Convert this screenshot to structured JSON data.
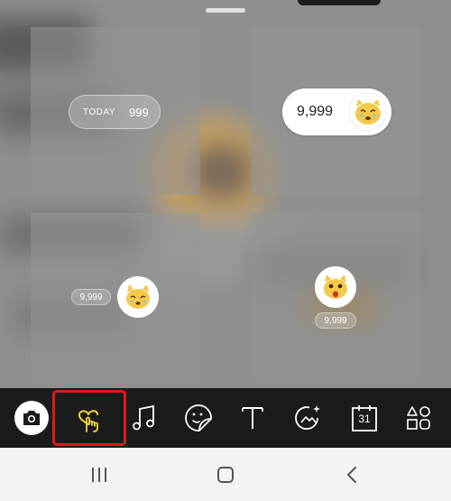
{
  "stickers": {
    "today_label": "TODAY",
    "today_value": "999",
    "big_count": "9,999",
    "left_count": "9,999",
    "right_count": "9,999"
  },
  "toolbar": {
    "tools": [
      {
        "name": "camera",
        "icon": "camera-icon"
      },
      {
        "name": "reaction",
        "icon": "heart-hand-icon",
        "selected": true,
        "highlight_color": "#e01818",
        "icon_color": "#f2d640"
      },
      {
        "name": "music",
        "icon": "music-note-icon"
      },
      {
        "name": "sticker",
        "icon": "sticker-icon"
      },
      {
        "name": "text",
        "icon": "text-icon"
      },
      {
        "name": "effect",
        "icon": "sparkle-image-icon"
      },
      {
        "name": "calendar",
        "icon": "calendar-icon",
        "label": "31"
      },
      {
        "name": "more",
        "icon": "shapes-icon"
      }
    ]
  },
  "navbar": {
    "buttons": [
      "recents-icon",
      "home-icon",
      "back-icon"
    ]
  },
  "colors": {
    "toolbar_bg": "#1b1b1b",
    "highlight": "#e01818",
    "selected_icon": "#f2d640",
    "face": "#f5c94a"
  }
}
